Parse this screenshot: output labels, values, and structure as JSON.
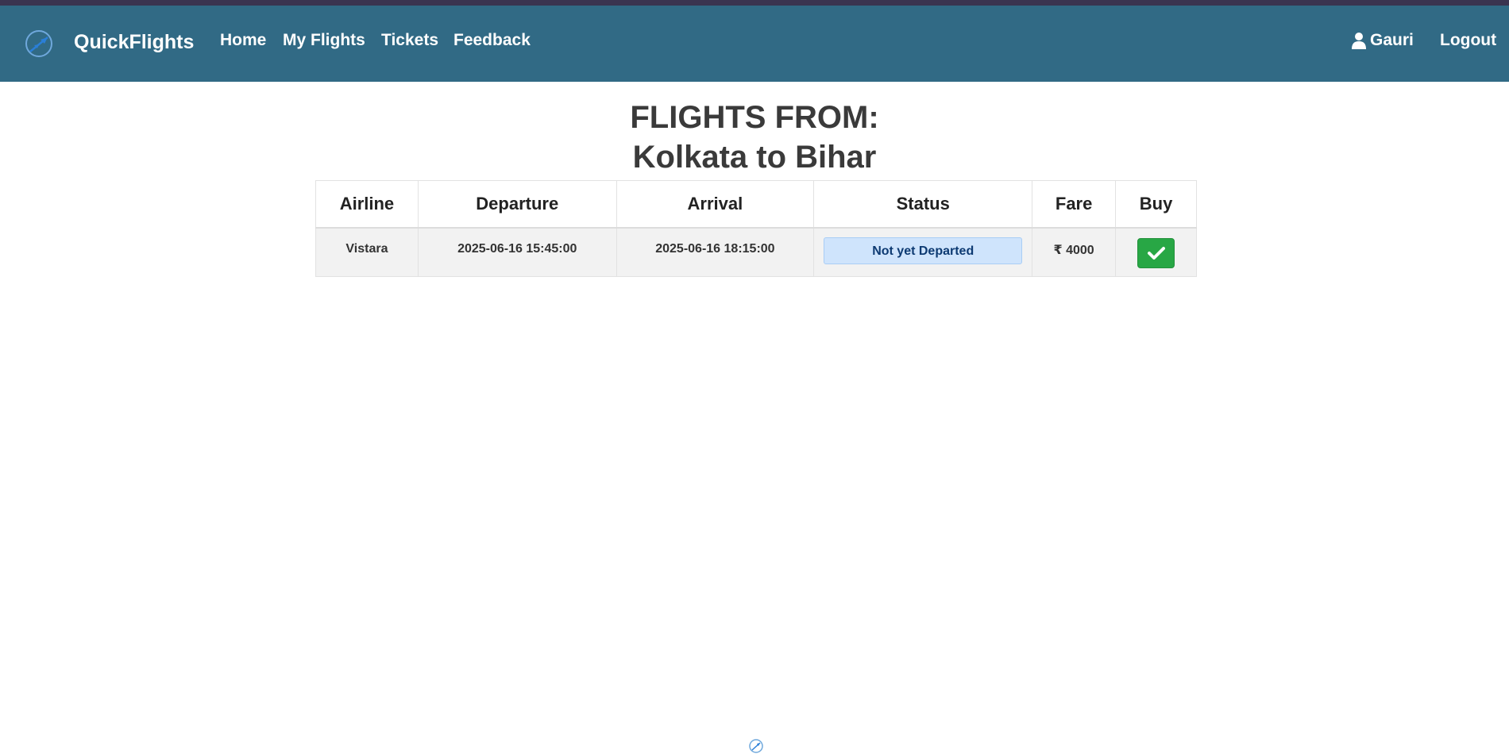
{
  "nav": {
    "brand": "QuickFlights",
    "links": [
      "Home",
      "My Flights",
      "Tickets",
      "Feedback"
    ],
    "user": "Gauri",
    "logout": "Logout"
  },
  "page": {
    "title_line1": "FLIGHTS FROM:",
    "title_line2": "Kolkata to Bihar"
  },
  "table": {
    "headers": [
      "Airline",
      "Departure",
      "Arrival",
      "Status",
      "Fare",
      "Buy"
    ],
    "rows": [
      {
        "airline": "Vistara",
        "departure": "2025-06-16 15:45:00",
        "arrival": "2025-06-16 18:15:00",
        "status": "Not yet Departed",
        "fare": "₹ 4000"
      }
    ]
  },
  "icons": {
    "brand": "plane-logo-icon",
    "user": "user-icon",
    "buy": "checkmark-icon"
  },
  "colors": {
    "navbar": "#316a85",
    "buy_button": "#28a745",
    "status_badge_bg": "#cfe4fc",
    "status_badge_text": "#0d3a72"
  }
}
